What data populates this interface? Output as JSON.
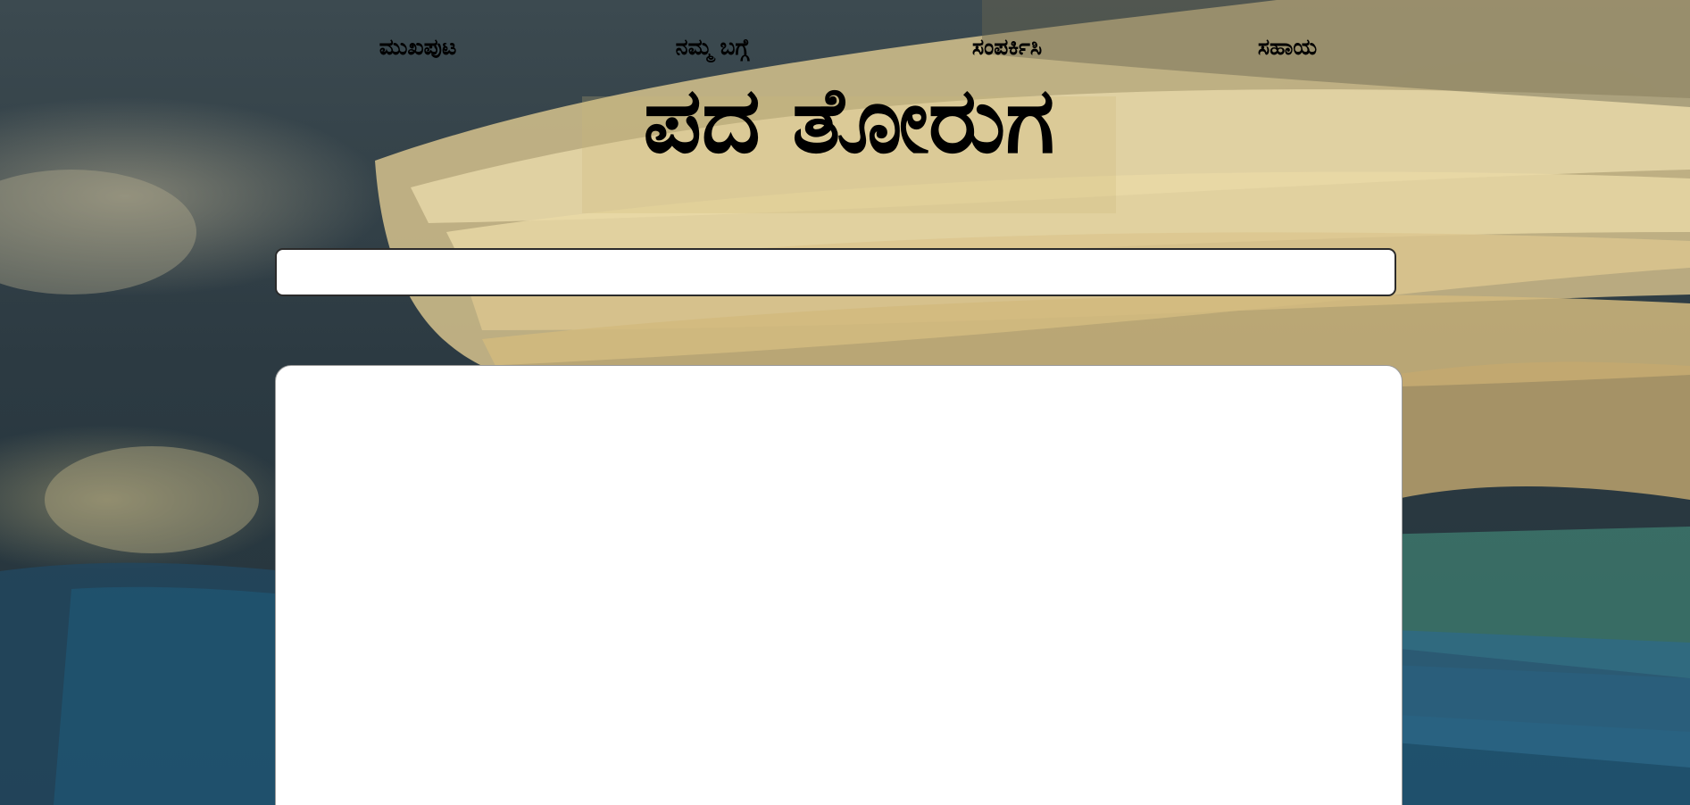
{
  "nav": {
    "items": [
      {
        "label": "ಮುಖಪುಟ"
      },
      {
        "label": "ನಮ್ಮ ಬಗ್ಗೆ"
      },
      {
        "label": "ಸಂಪರ್ಕಿಸಿ"
      },
      {
        "label": "ಸಹಾಯ"
      }
    ]
  },
  "header": {
    "title": "ಪದ ತೋರುಗ"
  },
  "search": {
    "value": "",
    "placeholder": ""
  },
  "results": {
    "content": ""
  },
  "colors": {
    "text": "#000000",
    "card_background": "#ffffff",
    "search_border": "#2b2b2b"
  },
  "background": {
    "image": "book-pages-photo"
  }
}
